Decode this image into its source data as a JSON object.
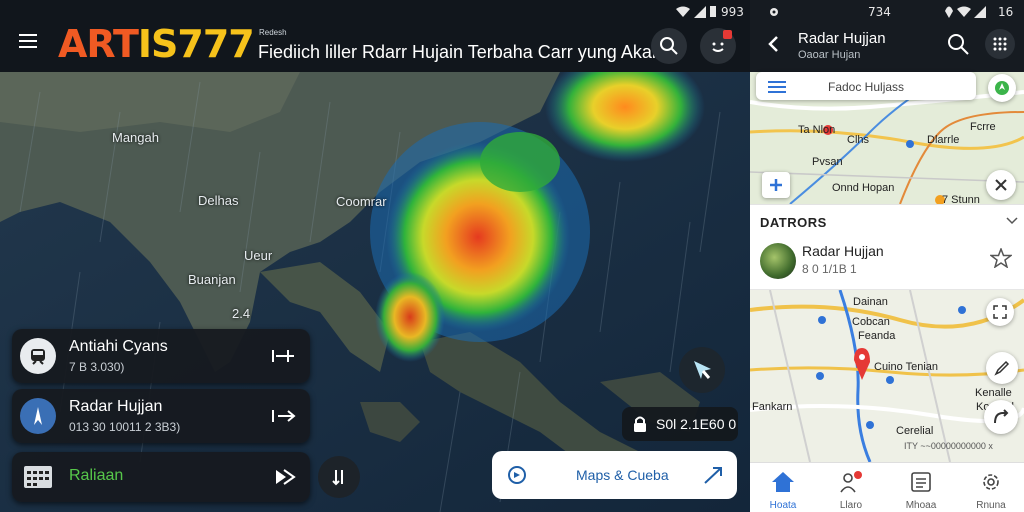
{
  "left_app": {
    "status_bar": {
      "time": "993"
    },
    "logo": {
      "part1": "ART",
      "part2": "IS777",
      "tag": "Redesh"
    },
    "headline": "Fiediich liller Rdarr Hujain Terbaha Carr yung Akarat",
    "map_labels": [
      "Mangah",
      "Delhas",
      "Ueur",
      "Buanjan",
      "Coomrar",
      "2.4"
    ],
    "cards": [
      {
        "title": "Antiahi Cyans",
        "sub": "7 B 3.030)",
        "icon": "train-icon"
      },
      {
        "title": "Radar Hujjan",
        "sub": "013 30 10011 2 3B3)",
        "icon": "radar-icon"
      },
      {
        "title": "Raliaan",
        "sub": "",
        "icon": "calendar-icon"
      }
    ],
    "time_chip": "S0l  2.1E60 0",
    "maps_label": "Maps & Cueba"
  },
  "right_app": {
    "status_bar": {
      "time": "734",
      "battery": "16"
    },
    "title": "Radar Hujjan",
    "subtitle": "Oaoar Hujan",
    "search_placeholder": "Fadoc Huljass",
    "map1_labels": [
      "Ta Nlon",
      "Clhs",
      "Dlarrle",
      "Fcrre",
      "Pvsan",
      "Onnd Hopan",
      "7 Stunn"
    ],
    "section_title": "DATRORS",
    "item": {
      "title": "Radar Hujjan",
      "sub": "8 0 1/1B 1"
    },
    "map2_labels": [
      "Dainan",
      "Cobcan",
      "Feanda",
      "Cuino Tenian",
      "Fankarn",
      "Cerelial",
      "Kenalle",
      "Korenol"
    ],
    "attribution": "ITY  ~~00000000000 x",
    "nav": [
      "Hoata",
      "Llaro",
      "Mhoaa",
      "Rnuna"
    ],
    "accent": "#2f72d6",
    "marker": "#e53935"
  }
}
